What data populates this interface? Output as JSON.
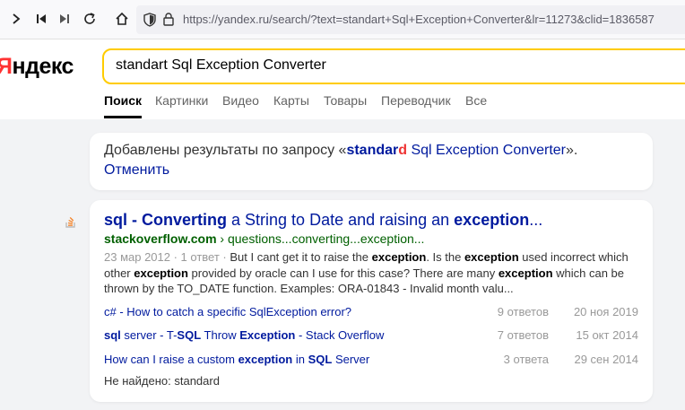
{
  "browser": {
    "url": "https://yandex.ru/search/?text=standart+Sql+Exception+Converter&lr=11273&clid=1836587"
  },
  "header": {
    "logo_ya": "Я",
    "logo_rest": "ндекс",
    "search_value": "standart Sql Exception Converter",
    "tabs": [
      {
        "label": "Поиск"
      },
      {
        "label": "Картинки"
      },
      {
        "label": "Видео"
      },
      {
        "label": "Карты"
      },
      {
        "label": "Товары"
      },
      {
        "label": "Переводчик"
      },
      {
        "label": "Все"
      }
    ]
  },
  "correction": {
    "prefix": "Добавлены результаты по запросу «",
    "query_bold_1": "standar",
    "query_bold_red": "d",
    "query_rest": " Sql Exception Converter",
    "suffix": "».",
    "cancel": "Отменить"
  },
  "result": {
    "title_b1": "sql - Converting",
    "title_t1": " a String to Date and raising an ",
    "title_b2": "exception",
    "title_t2": "...",
    "url_domain": "stackoverflow.com",
    "url_path": " › questions...converting...exception...",
    "snippet_meta": "23 мар 2012 · 1 ответ · ",
    "snippet_t1": "But I cant get it to raise the ",
    "snippet_b1": "exception",
    "snippet_t2": ". Is the ",
    "snippet_b2": "exception",
    "snippet_t3": " used incorrect which other ",
    "snippet_b3": "exception",
    "snippet_t4": " provided by oracle can I use for this case? There are many ",
    "snippet_b4": "exception",
    "snippet_t5": " which can be thrown by the TO_DATE function. Examples: ORA-01843 - Invalid month valu...",
    "sublinks": [
      {
        "t1": "c# - How to catch a specific SqlException error?",
        "count": "9 ответов",
        "date": "20 ноя 2019"
      },
      {
        "b1": "sql",
        "t1": " server - T-",
        "b2": "SQL",
        "t2": " Throw ",
        "b3": "Exception",
        "t3": " - Stack Overflow",
        "count": "7 ответов",
        "date": "15 окт 2014"
      },
      {
        "t1": "How can I raise a custom ",
        "b1": "exception",
        "t2": " in ",
        "b2": "SQL",
        "t3": " Server",
        "count": "3 ответа",
        "date": "29 сен 2014"
      }
    ],
    "not_found": "Не найдено: standard"
  }
}
